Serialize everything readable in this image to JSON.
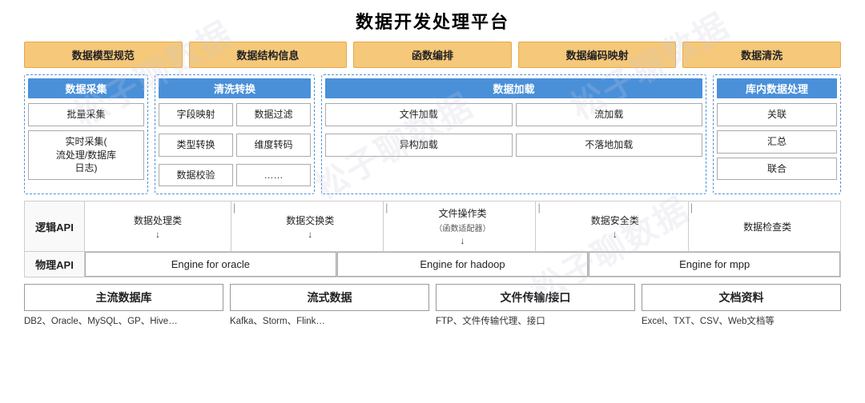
{
  "page": {
    "title": "数据开发处理平台"
  },
  "top_boxes": [
    "数据模型规范",
    "数据结构信息",
    "函数编排",
    "数据编码映射",
    "数据清洗"
  ],
  "sections": {
    "collection": {
      "header": "数据采集",
      "items": [
        "批量采集",
        "实时采集(\n流处理/数据库\n日志)"
      ]
    },
    "clean": {
      "header": "清洗转换",
      "items": [
        "字段映射",
        "数据过滤",
        "类型转换",
        "维度转码",
        "数据校验",
        "……"
      ]
    },
    "load": {
      "header": "数据加载",
      "items": [
        "文件加载",
        "流加载",
        "异构加载",
        "不落地加载"
      ]
    },
    "inhouse": {
      "header": "库内数据处理",
      "items": [
        "关联",
        "汇总",
        "联合"
      ]
    }
  },
  "api": {
    "logical": {
      "label": "逻辑API",
      "categories": [
        {
          "name": "数据处理类",
          "sub": ""
        },
        {
          "name": "数据交换类",
          "sub": ""
        },
        {
          "name": "文件操作类",
          "sub": "（函数适配器）"
        },
        {
          "name": "数据安全类",
          "sub": ""
        },
        {
          "name": "数据检查类",
          "sub": ""
        }
      ]
    },
    "physical": {
      "label": "物理API",
      "engines": [
        "Engine for oracle",
        "Engine for hadoop",
        "Engine for mpp"
      ]
    }
  },
  "bottom": [
    {
      "header": "主流数据库",
      "text": "DB2、Oracle、MySQL、GP、Hive…"
    },
    {
      "header": "流式数据",
      "text": "Kafka、Storm、Flink…"
    },
    {
      "header": "文件传输/接口",
      "text": "FTP、文件传输代理、接口"
    },
    {
      "header": "文档资料",
      "text": "Excel、TXT、CSV、Web文档等"
    }
  ],
  "watermarks": [
    "松子聊数据",
    "松子聊数据",
    "松子聊数据"
  ]
}
